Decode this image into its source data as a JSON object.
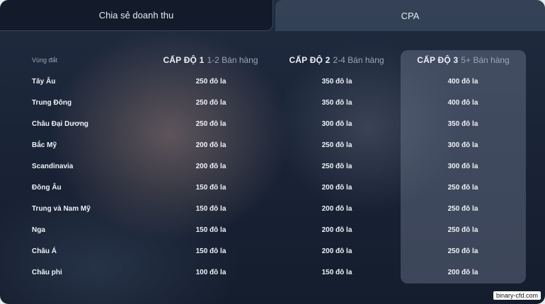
{
  "tabs": [
    {
      "label": "Chia sẻ doanh thu",
      "active": false
    },
    {
      "label": "CPA",
      "active": true
    }
  ],
  "table": {
    "region_header": "Vùng đất",
    "levels": [
      {
        "name": "CẤP ĐỘ 1",
        "range": "1-2 Bán hàng"
      },
      {
        "name": "CẤP ĐỘ 2",
        "range": "2-4 Bán hàng"
      },
      {
        "name": "CẤP ĐỘ 3",
        "range": "5+ Bán hàng"
      }
    ],
    "rows": [
      {
        "region": "Tây Âu",
        "values": [
          "250 đô la",
          "350 đô la",
          "400 đô la"
        ]
      },
      {
        "region": "Trung Đông",
        "values": [
          "250 đô la",
          "350 đô la",
          "400 đô la"
        ]
      },
      {
        "region": "Châu Đại Dương",
        "values": [
          "250 đô la",
          "300 đô la",
          "350 đô la"
        ]
      },
      {
        "region": "Bắc Mỹ",
        "values": [
          "200 đô la",
          "250 đô la",
          "300 đô la"
        ]
      },
      {
        "region": "Scandinavia",
        "values": [
          "200 đô la",
          "250 đô la",
          "300 đô la"
        ]
      },
      {
        "region": "Đông Âu",
        "values": [
          "150 đô la",
          "200 đô la",
          "250 đô la"
        ]
      },
      {
        "region": "Trung và Nam Mỹ",
        "values": [
          "150 đô la",
          "200 đô la",
          "250 đô la"
        ]
      },
      {
        "region": "Nga",
        "values": [
          "150 đô la",
          "200 đô la",
          "250 đô la"
        ]
      },
      {
        "region": "Châu Á",
        "values": [
          "150 đô la",
          "200 đô la",
          "250 đô la"
        ]
      },
      {
        "region": "Châu phi",
        "values": [
          "100 đô la",
          "150 đô la",
          "200 đô la"
        ]
      }
    ]
  },
  "watermark": "binary-cfd.com"
}
